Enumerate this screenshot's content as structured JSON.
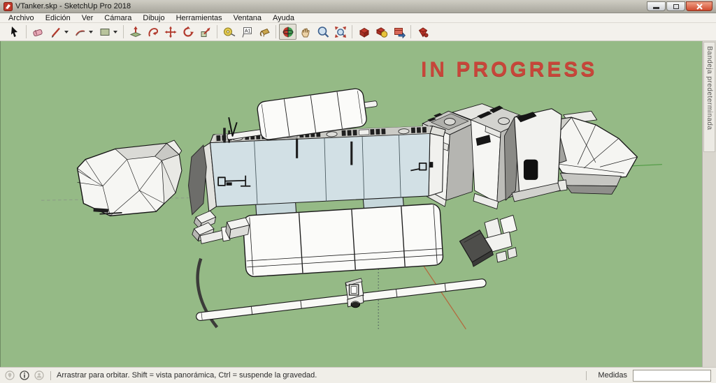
{
  "window": {
    "title": "VTanker.skp - SketchUp Pro 2018"
  },
  "menubar": {
    "items": [
      "Archivo",
      "Edición",
      "Ver",
      "Cámara",
      "Dibujo",
      "Herramientas",
      "Ventana",
      "Ayuda"
    ]
  },
  "toolbar": {
    "tools": [
      "select",
      "eraser",
      "line",
      "arc",
      "rectangle",
      "push-pull",
      "follow-me",
      "move",
      "rotate",
      "scale",
      "tape-measure",
      "text",
      "paint-bucket",
      "orbit",
      "pan",
      "zoom",
      "zoom-extents",
      "component",
      "component-options",
      "share-model",
      "model-info"
    ],
    "active_tool": "orbit",
    "text_tool_label": "A1"
  },
  "viewport": {
    "overlay_text": "IN PROGRESS",
    "background_color": "#95ba86",
    "axis_colors": {
      "red": "#b5673c",
      "green": "#4e9a42",
      "blue_dotted": "#3c4654"
    }
  },
  "tray": {
    "label": "Bandeja predeterminada"
  },
  "statusbar": {
    "hint": "Arrastrar para orbitar. Shift = vista panorámica, Ctrl = suspende la gravedad.",
    "measurements_label": "Medidas",
    "measurements_value": ""
  },
  "colors": {
    "overlay_red": "#c7463a",
    "frame_blue": "#d2e0e5",
    "close_button": "#cf4a2e"
  }
}
